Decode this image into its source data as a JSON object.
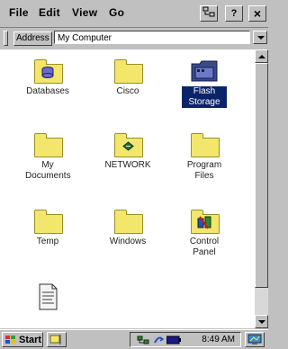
{
  "menu": {
    "file": "File",
    "edit": "Edit",
    "view": "View",
    "go": "Go",
    "help": "?",
    "close": "×"
  },
  "address": {
    "label": "Address",
    "value": "My Computer"
  },
  "items": [
    {
      "label": "Databases",
      "icon": "database-icon"
    },
    {
      "label": "Cisco",
      "icon": "folder-icon"
    },
    {
      "label": "Flash Storage",
      "icon": "storage-card-icon",
      "selected": true
    },
    {
      "label": "My Documents",
      "icon": "folder-icon"
    },
    {
      "label": "NETWORK",
      "icon": "network-folder-icon"
    },
    {
      "label": "Program Files",
      "icon": "folder-icon"
    },
    {
      "label": "Temp",
      "icon": "folder-icon"
    },
    {
      "label": "Windows",
      "icon": "folder-icon"
    },
    {
      "label": "Control Panel",
      "icon": "control-panel-icon"
    },
    {
      "label": "",
      "icon": "document-icon"
    }
  ],
  "taskbar": {
    "start": "Start",
    "clock": "8:49 AM"
  },
  "colors": {
    "face": "#c0c0c0",
    "selection": "#0a246a",
    "folder": "#f2e76a"
  }
}
